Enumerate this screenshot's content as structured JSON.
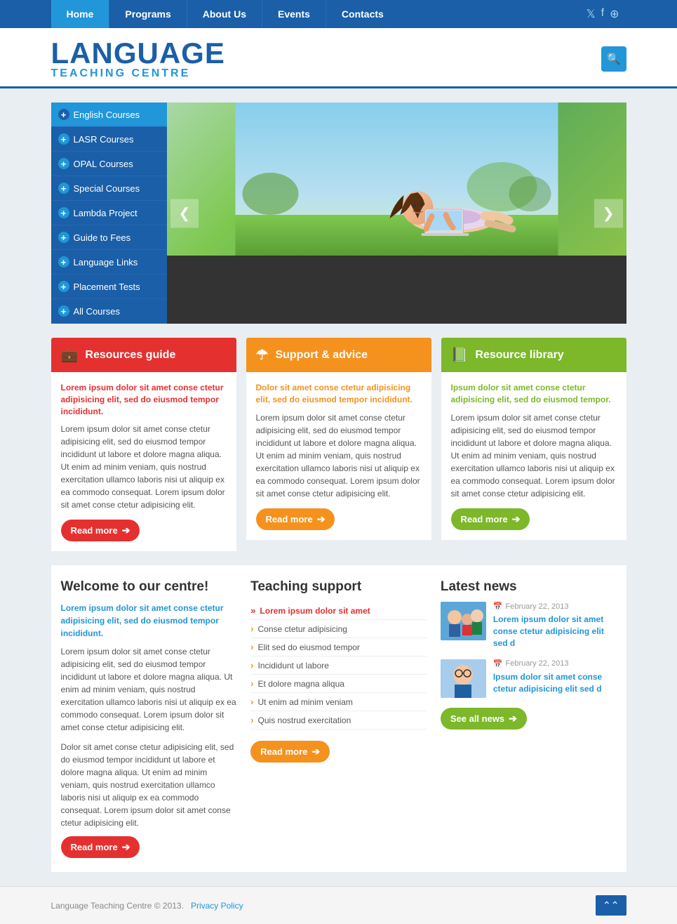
{
  "nav": {
    "items": [
      {
        "label": "Home",
        "active": true
      },
      {
        "label": "Programs",
        "active": false
      },
      {
        "label": "About Us",
        "active": false
      },
      {
        "label": "Events",
        "active": false
      },
      {
        "label": "Contacts",
        "active": false
      }
    ]
  },
  "logo": {
    "main": "LANGUAGE",
    "sub": "TEACHING CENTRE"
  },
  "sidebar": {
    "items": [
      "English Courses",
      "LASR Courses",
      "OPAL Courses",
      "Special Courses",
      "Lambda Project",
      "Guide to Fees",
      "Language Links",
      "Placement Tests",
      "All Courses"
    ]
  },
  "boxes": [
    {
      "title": "Resources guide",
      "color": "red",
      "highlight": "Lorem ipsum dolor sit amet conse ctetur adipisicing elit, sed do eiusmod tempor incididunt.",
      "body": "Lorem ipsum dolor sit amet conse ctetur adipisicing elit, sed do eiusmod tempor incididunt ut labore et dolore magna aliqua. Ut enim ad minim veniam, quis nostrud exercitation ullamco laboris nisi ut aliquip ex ea commodo consequat. Lorem ipsum dolor sit amet conse ctetur adipisicing elit.",
      "btn": "Read more"
    },
    {
      "title": "Support & advice",
      "color": "orange",
      "highlight": "Dolor sit amet conse ctetur adipisicing elit, sed do eiusmod tempor incididunt.",
      "body": "Lorem ipsum dolor sit amet conse ctetur adipisicing elit, sed do eiusmod tempor incididunt ut labore et dolore magna aliqua. Ut enim ad minim veniam, quis nostrud exercitation ullamco laboris nisi ut aliquip ex ea commodo consequat. Lorem ipsum dolor sit amet conse ctetur adipisicing elit.",
      "btn": "Read more"
    },
    {
      "title": "Resource library",
      "color": "green",
      "highlight": "Ipsum dolor sit amet conse ctetur adipisicing elit, sed do eiusmod tempor.",
      "body": "Lorem ipsum dolor sit amet conse ctetur adipisicing elit, sed do eiusmod tempor incididunt ut labore et dolore magna aliqua. Ut enim ad minim veniam, quis nostrud exercitation ullamco laboris nisi ut aliquip ex ea commodo consequat. Lorem ipsum dolor sit amet conse ctetur adipisicing elit.",
      "btn": "Read more"
    }
  ],
  "welcome": {
    "title": "Welcome to our centre!",
    "highlight": "Lorem ipsum dolor sit amet conse ctetur adipisicing elit, sed do eiusmod tempor incididunt.",
    "body1": "Lorem ipsum dolor sit amet conse ctetur adipisicing elit, sed do eiusmod tempor incididunt ut labore et dolore magna aliqua. Ut enim ad minim veniam, quis nostrud exercitation ullamco laboris nisi ut aliquip ex ea commodo consequat. Lorem ipsum dolor sit amet conse ctetur adipisicing elit.",
    "body2": "Dolor sit amet conse ctetur adipisicing elit, sed do eiusmod tempor incididunt ut labore et dolore magna aliqua. Ut enim ad minim veniam, quis nostrud exercitation ullamco laboris nisi ut aliquip ex ea commodo consequat. Lorem ipsum dolor sit amet conse ctetur adipisicing elit.",
    "btn": "Read more"
  },
  "teaching": {
    "title": "Teaching support",
    "items": [
      {
        "label": "Lorem ipsum dolor sit amet",
        "highlight": true
      },
      {
        "label": "Conse ctetur adipisicing",
        "highlight": false
      },
      {
        "label": "Elit sed do eiusmod tempor",
        "highlight": false
      },
      {
        "label": "Incididunt ut labore",
        "highlight": false
      },
      {
        "label": "Et dolore magna aliqua",
        "highlight": false
      },
      {
        "label": "Ut enim ad minim veniam",
        "highlight": false
      },
      {
        "label": "Quis nostrud exercitation",
        "highlight": false
      }
    ],
    "btn": "Read more"
  },
  "news": {
    "title": "Latest news",
    "items": [
      {
        "date": "February 22, 2013",
        "link": "Lorem ipsum dolor sit amet conse ctetur adipisicing elit sed d"
      },
      {
        "date": "February 22, 2013",
        "link": "Ipsum dolor sit amet conse ctetur adipisicing elit sed d"
      }
    ],
    "btn": "See all news"
  },
  "footer": {
    "copy": "Language Teaching Centre © 2013.",
    "link": "Privacy Policy"
  }
}
